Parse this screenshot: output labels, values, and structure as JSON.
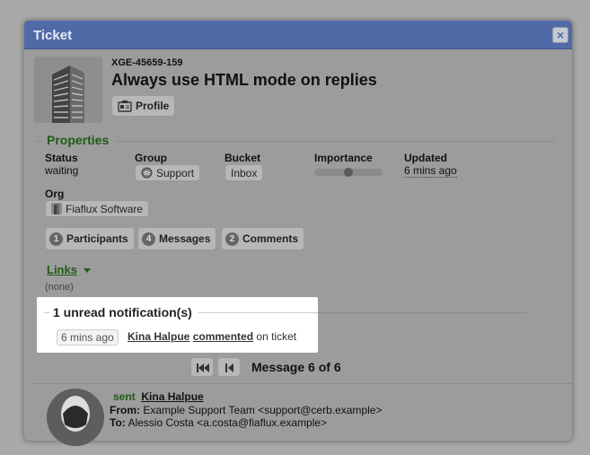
{
  "dialog": {
    "title": "Ticket",
    "close_icon": "×"
  },
  "ticket": {
    "id": "XGE-45659-159",
    "subject": "Always use HTML mode on replies",
    "profile_label": "Profile"
  },
  "properties": {
    "heading": "Properties",
    "status_label": "Status",
    "status_value": "waiting",
    "group_label": "Group",
    "group_value": "Support",
    "bucket_label": "Bucket",
    "bucket_value": "Inbox",
    "importance_label": "Importance",
    "importance_value": 0.5,
    "updated_label": "Updated",
    "updated_value": "6 mins ago",
    "org_label": "Org",
    "org_value": "Fiaflux Software"
  },
  "counts": {
    "participants": {
      "count": "1",
      "label": "Participants"
    },
    "messages": {
      "count": "4",
      "label": "Messages"
    },
    "comments": {
      "count": "2",
      "label": "Comments"
    }
  },
  "links": {
    "label": "Links",
    "empty": "(none)"
  },
  "notifications": {
    "title": "1 unread notification(s)",
    "time": "6 mins ago",
    "actor": "Kina Halpue",
    "action": "commented",
    "suffix": "on ticket"
  },
  "message_nav": {
    "label": "Message 6 of 6"
  },
  "message": {
    "sent_label": "sent",
    "sender": "Kina Halpue",
    "from_label": "From:",
    "from_value": "Example Support Team <support@cerb.example>",
    "to_label": "To:",
    "to_value": "Alessio Costa <a.costa@fiaflux.example>"
  },
  "colors": {
    "titlebar": "#4f6aa6",
    "section_green": "#1f5c14",
    "overlay_bg": "#9c9c9c"
  }
}
